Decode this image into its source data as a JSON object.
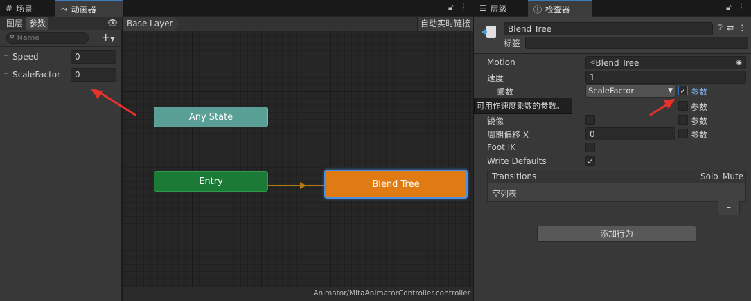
{
  "left_tabs": {
    "scene": "场景",
    "animator": "动画器"
  },
  "animator": {
    "subtabs": {
      "layers": "图层",
      "params": "参数"
    },
    "search_placeholder": "Name",
    "params": [
      {
        "name": "Speed",
        "value": "0"
      },
      {
        "name": "ScaleFactor",
        "value": "0"
      }
    ],
    "breadcrumb": "Base Layer",
    "live_link": "自动实时链接",
    "nodes": {
      "any_state": "Any State",
      "entry": "Entry",
      "blend_tree": "Blend Tree"
    },
    "footer_path": "Animator/MitaAnimatorController.controller"
  },
  "right_tabs": {
    "hierarchy": "层级",
    "inspector": "检查器"
  },
  "inspector": {
    "object_name": "Blend Tree",
    "tag_label": "标签",
    "motion_label": "Motion",
    "motion_value": "Blend Tree",
    "speed_label": "速度",
    "speed_value": "1",
    "multiplier_label": "乘数",
    "multiplier_value": "ScaleFactor",
    "param_label": "参数",
    "tooltip": "可用作速度乘数的参数。",
    "mirror_label": "镜像",
    "cycle_offset_label": "周期偏移 X",
    "cycle_offset_value": "0",
    "foot_ik_label": "Foot IK",
    "write_defaults_label": "Write Defaults",
    "transitions_label": "Transitions",
    "solo_label": "Solo",
    "mute_label": "Mute",
    "empty_list": "空列表",
    "minus": "–",
    "add_behaviour": "添加行为"
  },
  "colors": {
    "any_state": "#5a9f96",
    "entry": "#1a7a36",
    "blend_tree": "#e07a12",
    "accent": "#3a79bb",
    "red_arrow": "#e8312c"
  }
}
